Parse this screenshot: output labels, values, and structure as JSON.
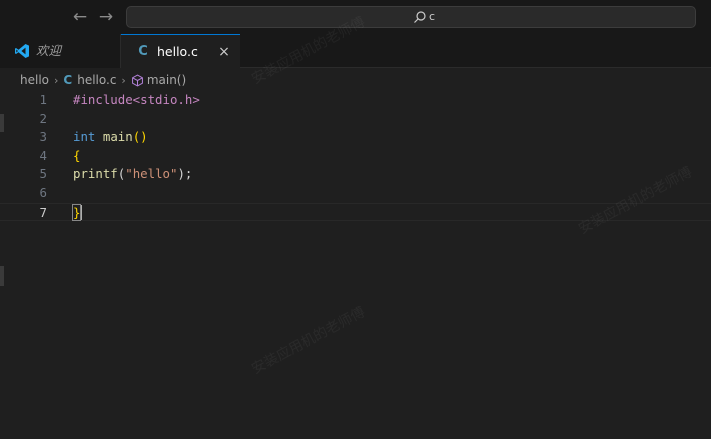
{
  "titlebar": {
    "back_icon": "arrow-left-icon",
    "forward_icon": "arrow-right-icon",
    "search_icon": "search-icon",
    "search_text": "c"
  },
  "tabs": [
    {
      "label": "欢迎",
      "icon": "vscode-logo-icon",
      "active": false
    },
    {
      "label": "hello.c",
      "icon": "c-file-icon",
      "icon_text": "C",
      "active": true,
      "close": "×"
    }
  ],
  "breadcrumb": {
    "folder": "hello",
    "file": "hello.c",
    "file_icon_text": "C",
    "symbol": "main()",
    "separator": "›"
  },
  "editor": {
    "current_line": 7,
    "lines": [
      {
        "num": "1",
        "tokens": [
          {
            "t": "#include<stdio.h>",
            "k": "pre"
          }
        ]
      },
      {
        "num": "2",
        "tokens": []
      },
      {
        "num": "3",
        "tokens": [
          {
            "t": "int",
            "k": "kw"
          },
          {
            "t": " ",
            "k": "punct"
          },
          {
            "t": "main",
            "k": "fn"
          },
          {
            "t": "()",
            "k": "brace"
          }
        ]
      },
      {
        "num": "4",
        "tokens": [
          {
            "t": "{",
            "k": "brace"
          }
        ]
      },
      {
        "num": "5",
        "tokens": [
          {
            "t": "printf",
            "k": "fn"
          },
          {
            "t": "(",
            "k": "punct"
          },
          {
            "t": "\"hello\"",
            "k": "str"
          },
          {
            "t": ");",
            "k": "punct"
          }
        ]
      },
      {
        "num": "6",
        "tokens": []
      },
      {
        "num": "7",
        "tokens": [
          {
            "t": "}",
            "k": "brace"
          }
        ]
      }
    ]
  },
  "watermark_text": "安装应用机的老师傅",
  "colors": {
    "accent": "#0078d4",
    "c_icon": "#519aba",
    "keyword": "#569cd6",
    "function": "#dcdcaa",
    "string": "#ce9178",
    "preprocessor": "#c586c0",
    "bracket": "#ffd700"
  }
}
